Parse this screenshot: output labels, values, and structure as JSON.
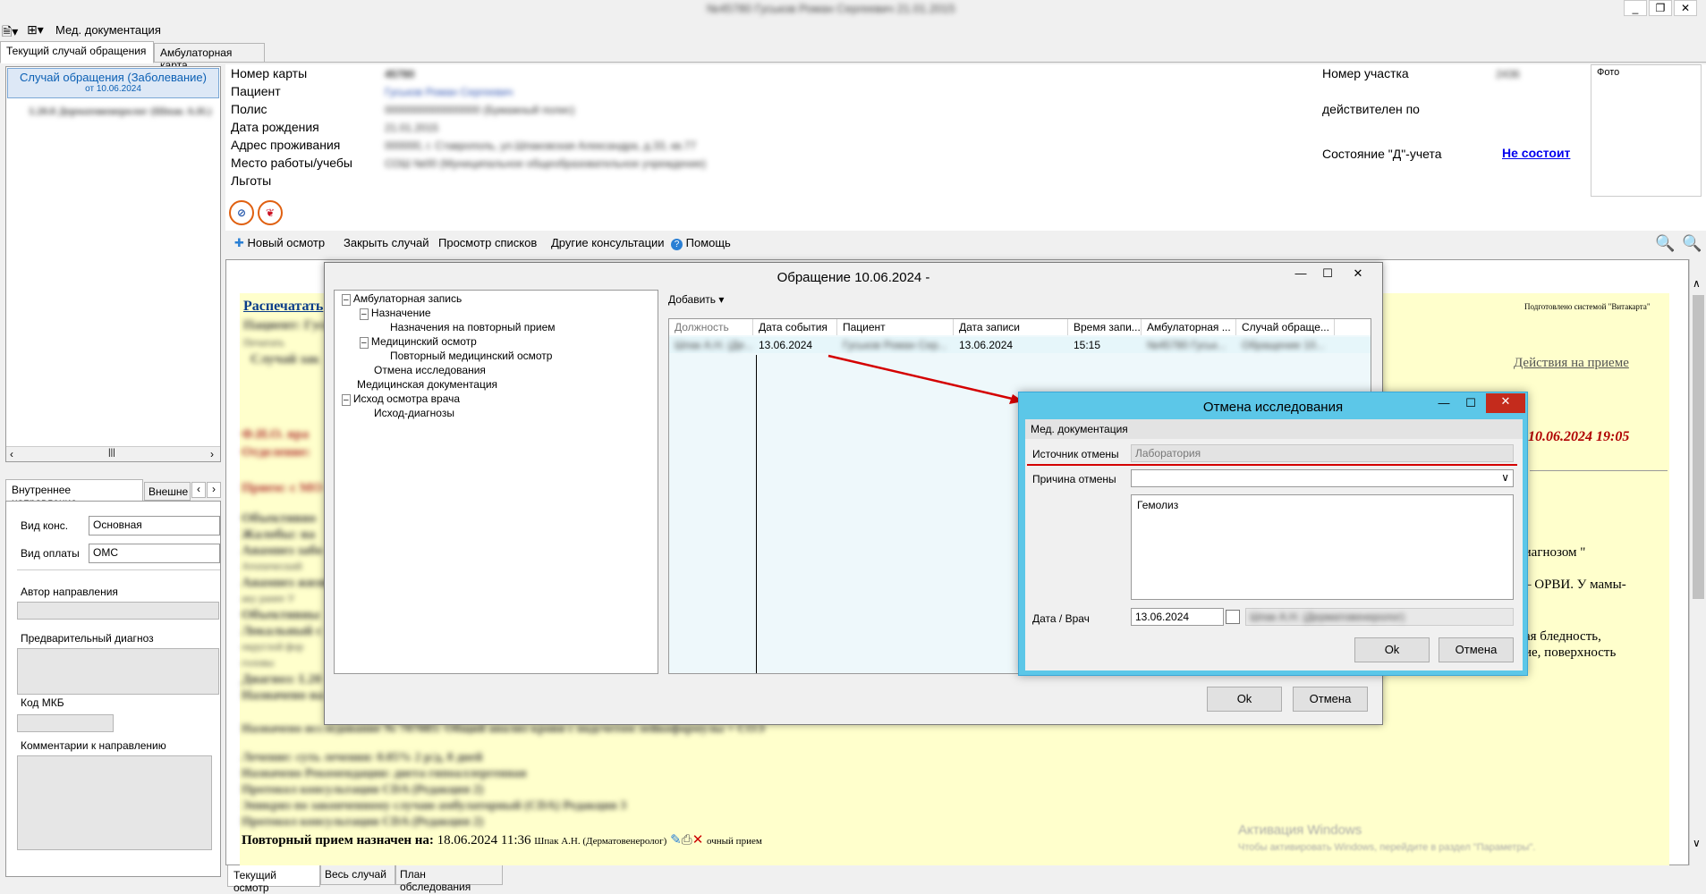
{
  "window": {
    "title": "№45780 Гуськов Роман Сергеевич 21.01.2015",
    "controls": [
      "_",
      "❐",
      "✕"
    ]
  },
  "menubar": {
    "doc_label": "Мед. документация"
  },
  "top_tabs": [
    "Текущий случай обращения",
    "Амбулаторная карта"
  ],
  "left_tree": {
    "case_title": "Случай обращения (Заболевание)",
    "case_date": "от 10.06.2024",
    "item": "L20.8 Дерматовенеролог (Шпак А.Н.)"
  },
  "left_tabs": [
    "Внутреннее направление",
    "Внешне"
  ],
  "referral": {
    "kind_label": "Вид конс.",
    "kind_value": "Основная",
    "payment_label": "Вид оплаты",
    "payment_value": "ОМС",
    "author_label": "Автор направления",
    "prelim_label": "Предварительный диагноз",
    "mkb_label": "Код МКБ",
    "comment_label": "Комментарии к направлению"
  },
  "patient": {
    "labels": [
      "Номер карты",
      "Пациент",
      "Полис",
      "Дата рождения",
      "Адрес проживания",
      "Место работы/учебы",
      "Льготы"
    ],
    "values": [
      "45780",
      "Гуськов Роман Сергеевич",
      "0000000000000000 (Бумажный полис)",
      "21.01.2015",
      "000000, г. Ставрополь, ул.Шпаковская Александра, д.33, кв.77",
      "СОШ №00 (Муниципальное общеобразовательное учреждение)",
      ""
    ],
    "district_label": "Номер участка",
    "district_value": "2436",
    "valid_label": "действителен по",
    "d_label": "Состояние \"Д\"-учета",
    "d_value": "Не состоит",
    "photo_label": "Фото"
  },
  "toolbar": [
    "Новый осмотр",
    "Закрыть случай",
    "Просмотр списков",
    "Другие консультации",
    "Помощь"
  ],
  "doc": {
    "print_link": "Распечатать",
    "prepared": "Подготовлено системой \"Витакарта\"",
    "actions_link": "Действия на приеме",
    "patient_line": "Пациент: Гуськов",
    "print_chk": "Печатать",
    "case_line": "Случай зак",
    "fio_line": "Ф.И.О. вра",
    "dept_line": "Отделение:",
    "date_right": "10.06.2024 19:05",
    "reception": "Прием: с МО",
    "right_text_1": "диагнозом \"",
    "right_text_2": "– ОРВИ. У мамы-",
    "right_text_3": "ая бледность,",
    "right_text_4": "ие, поверхность",
    "left_lines": [
      "Объективно",
      "Жалобы: на",
      "Анамнез забо",
      "Атопический",
      "Анамнез жизн",
      "аку ранее У",
      "Объективны",
      "Локальный с",
      "округлой фор",
      "головы",
      "Диагноз: L20",
      "Назначено на"
    ],
    "assignment": "Назначено исследование № 707085: Общий анализ крови с подсчетом лейкоформулы + СОЭ",
    "treatment": "Лечение: суть лечения: 0.05% 2 р/д, 8 дней",
    "recommend": "Назначено Рекомендации: диета гипоаллергенная",
    "protocol1": "Протокол консультации CDA (Редакция 2)",
    "epicrisis": "Эпикриз по законченному случаю амбулаторный (CDA) Редакция 3",
    "protocol2": "Протокол консультации CDA (Редакция 2)",
    "repeat_prefix": "Повторный прием назначен на:",
    "repeat_value": "18.06.2024 11:36",
    "repeat_doctor": "Шпак А.Н. (Дерматовенеролог)",
    "repeat_type": "очный прием",
    "watermark1": "Активация Windows",
    "watermark2": "Чтобы активировать Windows, перейдите в раздел \"Параметры\"."
  },
  "bottom_tabs": [
    "Текущий осмотр",
    "Весь случай",
    "План обследования"
  ],
  "dialog_main": {
    "title": "Обращение 10.06.2024 -",
    "tree": [
      "Амбулаторная запись",
      "Назначение",
      "Назначения на повторный прием",
      "Медицинский осмотр",
      "Повторный медицинский осмотр",
      "Отмена исследования",
      "Медицинская документация",
      "Исход осмотра врача",
      "Исход-диагнозы"
    ],
    "add_label": "Добавить",
    "columns": [
      "Должность",
      "Дата события",
      "Пациент",
      "Дата записи",
      "Время запи...",
      "Амбулаторная ...",
      "Случай обраще..."
    ],
    "row": [
      "Шпак А.Н. (Де...",
      "13.06.2024",
      "Гуськов Роман Сер...",
      "13.06.2024",
      "15:15",
      "№45780 Гуськ...",
      "Обращение 10..."
    ],
    "ok": "Ok",
    "cancel": "Отмена"
  },
  "dialog_cancel": {
    "title": "Отмена исследования",
    "section": "Мед. документация",
    "source_label": "Источник отмены",
    "source_value": "Лаборатория",
    "reason_label": "Причина отмены",
    "reason_value": "",
    "text_value": "Гемолиз",
    "date_label": "Дата / Врач",
    "date_value": "13.06.2024",
    "doctor_value": "Шпак А.Н. (Дерматовенеролог)",
    "ok": "Ok",
    "cancel": "Отмена"
  },
  "colors": {
    "accent": "#0a5fb4",
    "dialog_border": "#5cc7e8",
    "annotation": "#d40000",
    "doc_bg": "#ffffcc",
    "link": "#0000ee"
  }
}
